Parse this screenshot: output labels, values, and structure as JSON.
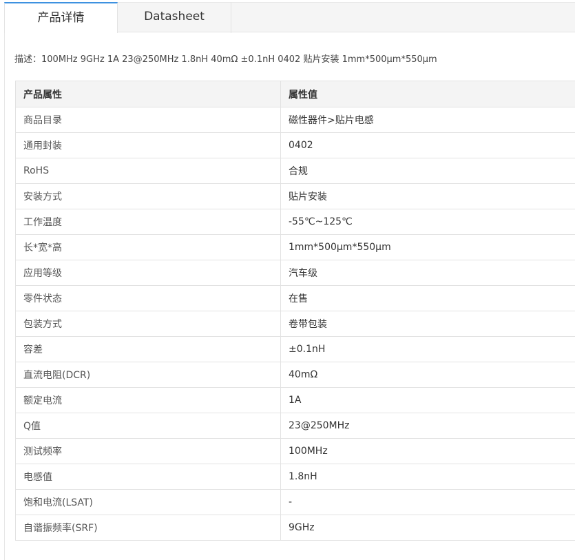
{
  "tabs": [
    {
      "label": "产品详情",
      "active": true
    },
    {
      "label": "Datasheet",
      "active": false
    }
  ],
  "description": "描述：100MHz 9GHz 1A 23@250MHz 1.8nH 40mΩ ±0.1nH 0402 贴片安装 1mm*500µm*550µm",
  "table": {
    "headers": [
      "产品属性",
      "属性值"
    ],
    "rows": [
      [
        "商品目录",
        "磁性器件>贴片电感"
      ],
      [
        "通用封装",
        "0402"
      ],
      [
        "RoHS",
        "合规"
      ],
      [
        "安装方式",
        "贴片安装"
      ],
      [
        "工作温度",
        "-55℃~125℃"
      ],
      [
        "长*宽*高",
        "1mm*500µm*550µm"
      ],
      [
        "应用等级",
        "汽车级"
      ],
      [
        "零件状态",
        "在售"
      ],
      [
        "包装方式",
        "卷带包装"
      ],
      [
        "容差",
        "±0.1nH"
      ],
      [
        "直流电阻(DCR)",
        "40mΩ"
      ],
      [
        "额定电流",
        "1A"
      ],
      [
        "Q值",
        "23@250MHz"
      ],
      [
        "测试频率",
        "100MHz"
      ],
      [
        "电感值",
        "1.8nH"
      ],
      [
        "饱和电流(LSAT)",
        "-"
      ],
      [
        "自谐振频率(SRF)",
        "9GHz"
      ]
    ]
  }
}
